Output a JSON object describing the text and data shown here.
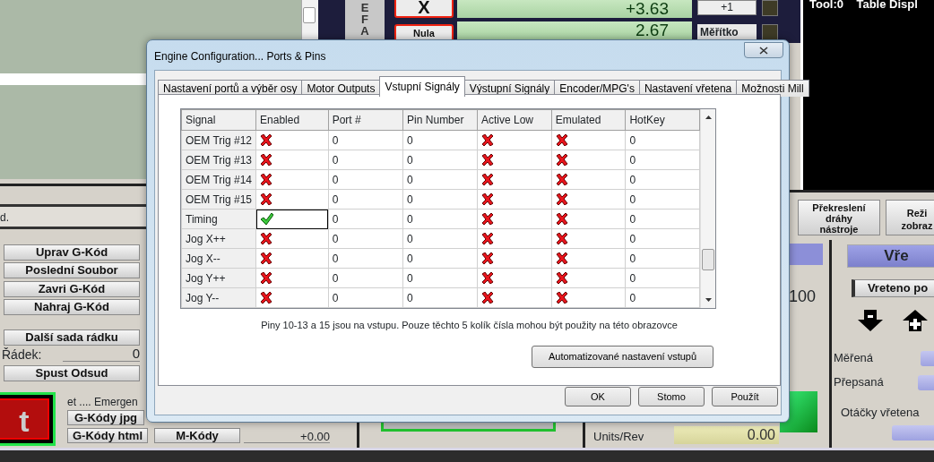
{
  "background": {
    "axis_letters": [
      "E",
      "F",
      "A"
    ],
    "axis_button": "X",
    "zero_button": "Nula",
    "dro_values": [
      "+3.63",
      "2.67"
    ],
    "step_value": "+1",
    "scale_label": "Měřítko",
    "tool_display": "Tool:0    Table Displ",
    "status_text": "d.",
    "file_buttons": [
      "Uprav G-Kód",
      "Poslední Soubor",
      "Zavri G-Kód",
      "Nahraj G-Kód"
    ],
    "next_lines_button": "Další sada rádku",
    "line_label": "Řádek:",
    "line_value": "0",
    "run_from_here_button": "Spust Odsud",
    "reset_button": "t",
    "emergency_text": "et .... Emergen",
    "code_buttons": [
      "G-Kódy jpg",
      "G-Kódy html",
      "M-Kódy"
    ],
    "offset_value": "+0.00",
    "feed_label": "Units/Rev",
    "feed_value": "0.00",
    "redraw_button": [
      "Překreslení",
      "dráhy",
      "nástroje"
    ],
    "view_mode_button": [
      "Reži",
      "zobraz"
    ],
    "override_value": "100",
    "spindle_title": "Vře",
    "spindle_toggle": "Vreteno po",
    "spindle_rows": [
      "Měřená",
      "Přepsaná"
    ],
    "spindle_speed_label": "Otáčky vřetena"
  },
  "dialog": {
    "title": "Engine Configuration... Ports & Pins",
    "tabs": [
      {
        "label": "Nastavení portů a výběr osy",
        "selected": false
      },
      {
        "label": "Motor Outputs",
        "selected": false
      },
      {
        "label": "Vstupní Signály",
        "selected": true
      },
      {
        "label": "Výstupní Signály",
        "selected": false
      },
      {
        "label": "Encoder/MPG's",
        "selected": false
      },
      {
        "label": "Nastavení vřetena",
        "selected": false
      },
      {
        "label": "Možnosti Mill",
        "selected": false
      }
    ],
    "columns": [
      "Signal",
      "Enabled",
      "Port #",
      "Pin Number",
      "Active Low",
      "Emulated",
      "HotKey"
    ],
    "rows": [
      {
        "signal": "OEM Trig #12",
        "enabled": false,
        "port": "0",
        "pin": "0",
        "active_low": false,
        "emulated": false,
        "hotkey": "0",
        "selected": false
      },
      {
        "signal": "OEM Trig #13",
        "enabled": false,
        "port": "0",
        "pin": "0",
        "active_low": false,
        "emulated": false,
        "hotkey": "0",
        "selected": false
      },
      {
        "signal": "OEM Trig #14",
        "enabled": false,
        "port": "0",
        "pin": "0",
        "active_low": false,
        "emulated": false,
        "hotkey": "0",
        "selected": false
      },
      {
        "signal": "OEM Trig #15",
        "enabled": false,
        "port": "0",
        "pin": "0",
        "active_low": false,
        "emulated": false,
        "hotkey": "0",
        "selected": false
      },
      {
        "signal": "Timing",
        "enabled": true,
        "port": "0",
        "pin": "0",
        "active_low": false,
        "emulated": false,
        "hotkey": "0",
        "selected": true
      },
      {
        "signal": "Jog X++",
        "enabled": false,
        "port": "0",
        "pin": "0",
        "active_low": false,
        "emulated": false,
        "hotkey": "0",
        "selected": false
      },
      {
        "signal": "Jog X--",
        "enabled": false,
        "port": "0",
        "pin": "0",
        "active_low": false,
        "emulated": false,
        "hotkey": "0",
        "selected": false
      },
      {
        "signal": "Jog Y++",
        "enabled": false,
        "port": "0",
        "pin": "0",
        "active_low": false,
        "emulated": false,
        "hotkey": "0",
        "selected": false
      },
      {
        "signal": "Jog Y--",
        "enabled": false,
        "port": "0",
        "pin": "0",
        "active_low": false,
        "emulated": false,
        "hotkey": "0",
        "selected": false
      }
    ],
    "note": "Piny 10-13 a 15 jsou na vstupu. Pouze těchto 5 kolík čísla mohou být použity na této obrazovce",
    "auto_button": "Automatizované nastavení vstupů",
    "buttons": [
      "OK",
      "Stomo",
      "Použít"
    ]
  }
}
